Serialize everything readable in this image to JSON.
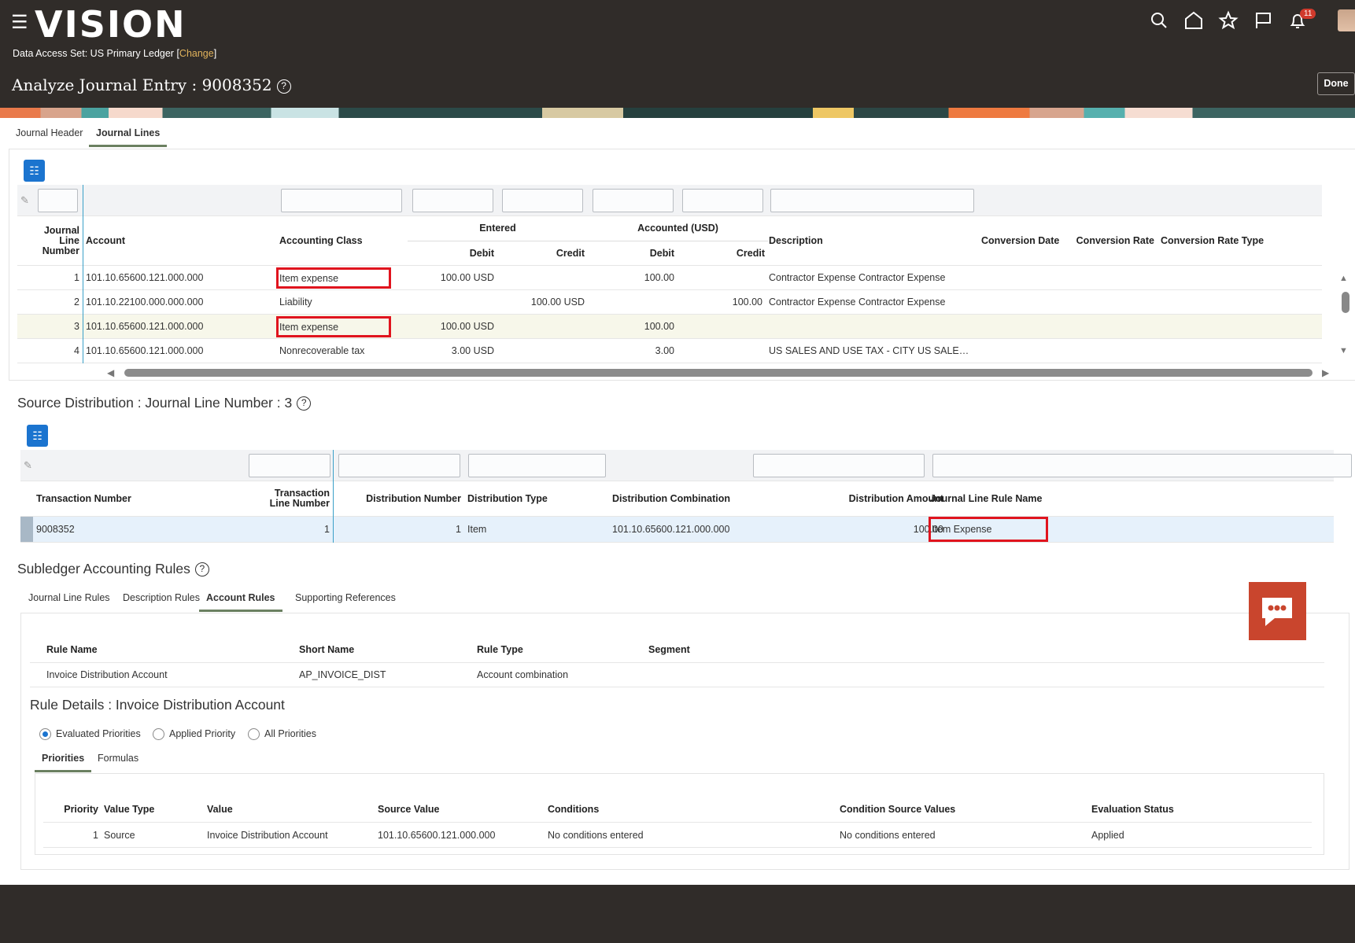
{
  "header": {
    "logo": "VISION",
    "data_access_label": "Data Access Set:",
    "data_access_value": "US Primary Ledger",
    "change_link": "Change",
    "title": "Analyze Journal Entry : 9008352",
    "help": "?",
    "notifications_count": "11",
    "done_label": "Done",
    "icons": [
      "menu-icon",
      "search-icon",
      "home-icon",
      "star-icon",
      "flag-icon",
      "bell-icon"
    ]
  },
  "tabs": [
    {
      "label": "Journal Header",
      "active": false
    },
    {
      "label": "Journal Lines",
      "active": true
    }
  ],
  "journal_lines": {
    "columns": {
      "line": "Journal Line Number",
      "account": "Account",
      "accounting_class": "Accounting Class",
      "entered": "Entered",
      "accounted": "Accounted (USD)",
      "debit": "Debit",
      "credit": "Credit",
      "description": "Description",
      "conversion_date": "Conversion Date",
      "conversion_rate": "Conversion Rate",
      "conversion_rate_type": "Conversion Rate Type"
    },
    "rows": [
      {
        "line": "1",
        "account": "101.10.65600.121.000.000",
        "accounting_class": "Item expense",
        "entered_debit": "100.00 USD",
        "entered_credit": "",
        "accounted_debit": "100.00",
        "accounted_credit": "",
        "description": "Contractor Expense Contractor Expense",
        "highlighted": true,
        "selected": false
      },
      {
        "line": "2",
        "account": "101.10.22100.000.000.000",
        "accounting_class": "Liability",
        "entered_debit": "",
        "entered_credit": "100.00 USD",
        "accounted_debit": "",
        "accounted_credit": "100.00",
        "description": "Contractor Expense Contractor Expense",
        "highlighted": false,
        "selected": false
      },
      {
        "line": "3",
        "account": "101.10.65600.121.000.000",
        "accounting_class": "Item expense",
        "entered_debit": "100.00 USD",
        "entered_credit": "",
        "accounted_debit": "100.00",
        "accounted_credit": "",
        "description": "",
        "highlighted": true,
        "selected": true
      },
      {
        "line": "4",
        "account": "101.10.65600.121.000.000",
        "accounting_class": "Nonrecoverable tax",
        "entered_debit": "3.00 USD",
        "entered_credit": "",
        "accounted_debit": "3.00",
        "accounted_credit": "",
        "description": "US SALES AND USE TAX - CITY US SALE…",
        "highlighted": false,
        "selected": false
      }
    ]
  },
  "source_distribution": {
    "title": "Source Distribution : Journal Line Number : 3",
    "columns": {
      "txn_number": "Transaction Number",
      "txn_line": "Transaction Line Number",
      "dist_number": "Distribution Number",
      "dist_type": "Distribution Type",
      "dist_comb": "Distribution Combination",
      "dist_amount": "Distribution Amount",
      "rule_name": "Journal Line Rule Name"
    },
    "rows": [
      {
        "txn_number": "9008352",
        "txn_line": "1",
        "dist_number": "1",
        "dist_type": "Item",
        "dist_comb": "101.10.65600.121.000.000",
        "dist_amount": "100.00",
        "rule_name": "Item Expense"
      }
    ]
  },
  "subledger": {
    "title": "Subledger Accounting Rules",
    "tabs": [
      {
        "label": "Journal Line Rules",
        "active": false
      },
      {
        "label": "Description Rules",
        "active": false
      },
      {
        "label": "Account Rules",
        "active": true
      },
      {
        "label": "Supporting References",
        "active": false
      }
    ],
    "rules_columns": {
      "rule_name": "Rule Name",
      "short_name": "Short Name",
      "rule_type": "Rule Type",
      "segment": "Segment"
    },
    "rules_rows": [
      {
        "rule_name": "Invoice Distribution Account",
        "short_name": "AP_INVOICE_DIST",
        "rule_type": "Account combination",
        "segment": ""
      }
    ],
    "details_title": "Rule Details : Invoice Distribution Account",
    "radios": [
      {
        "label": "Evaluated Priorities",
        "selected": true
      },
      {
        "label": "Applied Priority",
        "selected": false
      },
      {
        "label": "All Priorities",
        "selected": false
      }
    ],
    "detail_tabs": [
      {
        "label": "Priorities",
        "active": true
      },
      {
        "label": "Formulas",
        "active": false
      }
    ],
    "priority_columns": {
      "priority": "Priority",
      "value_type": "Value Type",
      "value": "Value",
      "source_value": "Source Value",
      "conditions": "Conditions",
      "condition_source_values": "Condition Source Values",
      "evaluation_status": "Evaluation Status"
    },
    "priority_rows": [
      {
        "priority": "1",
        "value_type": "Source",
        "value": "Invoice Distribution Account",
        "source_value": "101.10.65600.121.000.000",
        "conditions": "No conditions entered",
        "condition_source_values": "No conditions entered",
        "evaluation_status": "Applied"
      }
    ]
  },
  "colors": {
    "header_bg": "#302c29",
    "accent": "#1b74cf",
    "highlight": "#e0141e",
    "selected_row": "#f7f7ea",
    "active_row": "#e6f1fb",
    "chat": "#c9452d"
  }
}
